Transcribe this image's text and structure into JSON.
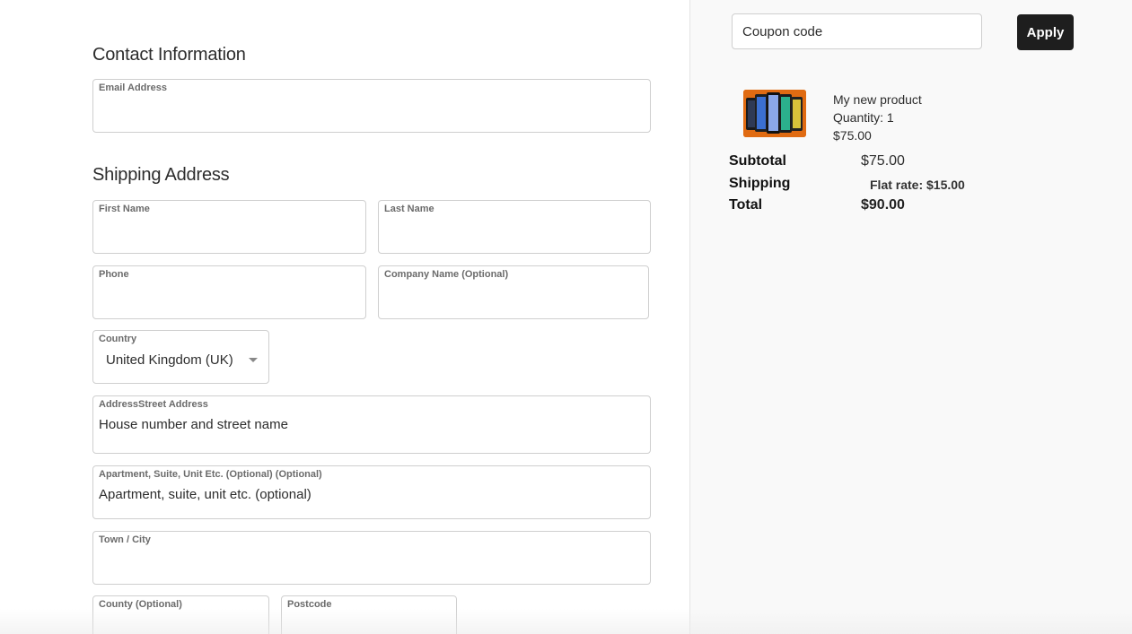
{
  "contact": {
    "title": "Contact Information",
    "email_label": "Email Address"
  },
  "shipping": {
    "title": "Shipping Address",
    "first_name_label": "First Name",
    "last_name_label": "Last Name",
    "phone_label": "Phone",
    "company_label": "Company Name (Optional)",
    "country_label": "Country",
    "country_value": "United Kingdom (UK)",
    "street_label": "AddressStreet Address",
    "street_placeholder": "House number and street name",
    "apartment_label": "Apartment, Suite, Unit Etc. (Optional) (Optional)",
    "apartment_placeholder": "Apartment, suite, unit etc. (optional)",
    "city_label": "Town / City",
    "county_label": "County (Optional)",
    "postcode_label": "Postcode"
  },
  "coupon": {
    "placeholder": "Coupon code",
    "apply_label": "Apply"
  },
  "product": {
    "name": "My new product",
    "quantity": "Quantity: 1",
    "price": "$75.00",
    "thumbnail_icon": "phones-image"
  },
  "totals": {
    "subtotal_label": "Subtotal",
    "subtotal_value": "$75.00",
    "shipping_label": "Shipping",
    "shipping_value": "Flat rate: $15.00",
    "total_label": "Total",
    "total_value": "$90.00"
  },
  "colors": {
    "button_bg": "#1e1e1e",
    "sidebar_bg": "#f9f9f9",
    "thumbnail_bg": "#e06b12"
  }
}
